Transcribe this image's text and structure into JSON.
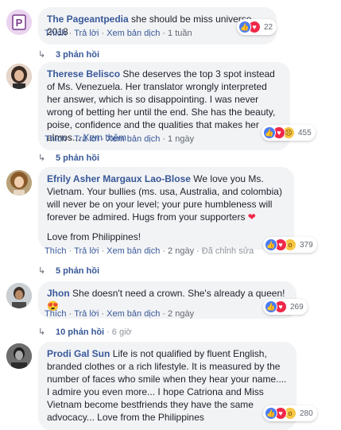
{
  "ui": {
    "like": "Thích",
    "reply": "Trả lời",
    "see_translation": "Xem bản dịch",
    "see_more": "Xem thêm",
    "edited": "Đã chỉnh sửa"
  },
  "comments": [
    {
      "author": "The Pageantpedia",
      "text": "she should be miss universe 2018",
      "time": "1 tuần",
      "reaction_count": "22",
      "reaction_icons": [
        "like-icon",
        "love-icon"
      ]
    },
    {
      "author": "Therese Belisco",
      "text": "She deserves the top 3 spot instead of Ms. Venezuela. Her translator wrongly interpreted her answer, which is so disappointing. I was never wrong of betting her until the end. She has the beauty, poise, confidence and the qualities that makes her almos...",
      "time": "1 ngày",
      "reaction_count": "455",
      "reaction_icons": [
        "like-icon",
        "love-icon",
        "sad-icon"
      ],
      "replies": "5 phản hồi"
    },
    {
      "author": "Efrily Asher Margaux Lao-Blose",
      "text": "We love you Ms. Vietnam. Your bullies (ms. usa, Australia, and colombia) will never be on your level; your pure humbleness will forever be admired. Hugs from your supporters",
      "text2": "Love from Philippines!",
      "time": "2 ngày",
      "reaction_count": "379",
      "reaction_icons": [
        "like-icon",
        "love-icon",
        "wow-icon"
      ],
      "replies": "5 phản hồi"
    },
    {
      "author": "Jhon",
      "text": "She doesn't need a crown. She's already a queen!",
      "time": "2 ngày",
      "reaction_count": "269",
      "reaction_icons": [
        "like-icon",
        "love-icon"
      ],
      "replies": "10 phản hồi",
      "replies_time": "6 giờ"
    },
    {
      "author": "Prodi Gal Sun",
      "text": "Life is not qualified by fluent English, branded clothes or a rich lifestyle. It is measured by the number of faces who smile when they hear your name.... I admire you even more... I hope Catriona and Miss Vietnam become bestfriends they have the same advocacy... Love from the Philippines",
      "reaction_count": "280",
      "reaction_icons": [
        "like-icon",
        "love-icon",
        "wow-icon"
      ]
    }
  ],
  "top_replies": "3 phản hồi",
  "colors": {
    "link": "#385898",
    "bubble": "#f2f3f5",
    "meta": "#606770"
  }
}
